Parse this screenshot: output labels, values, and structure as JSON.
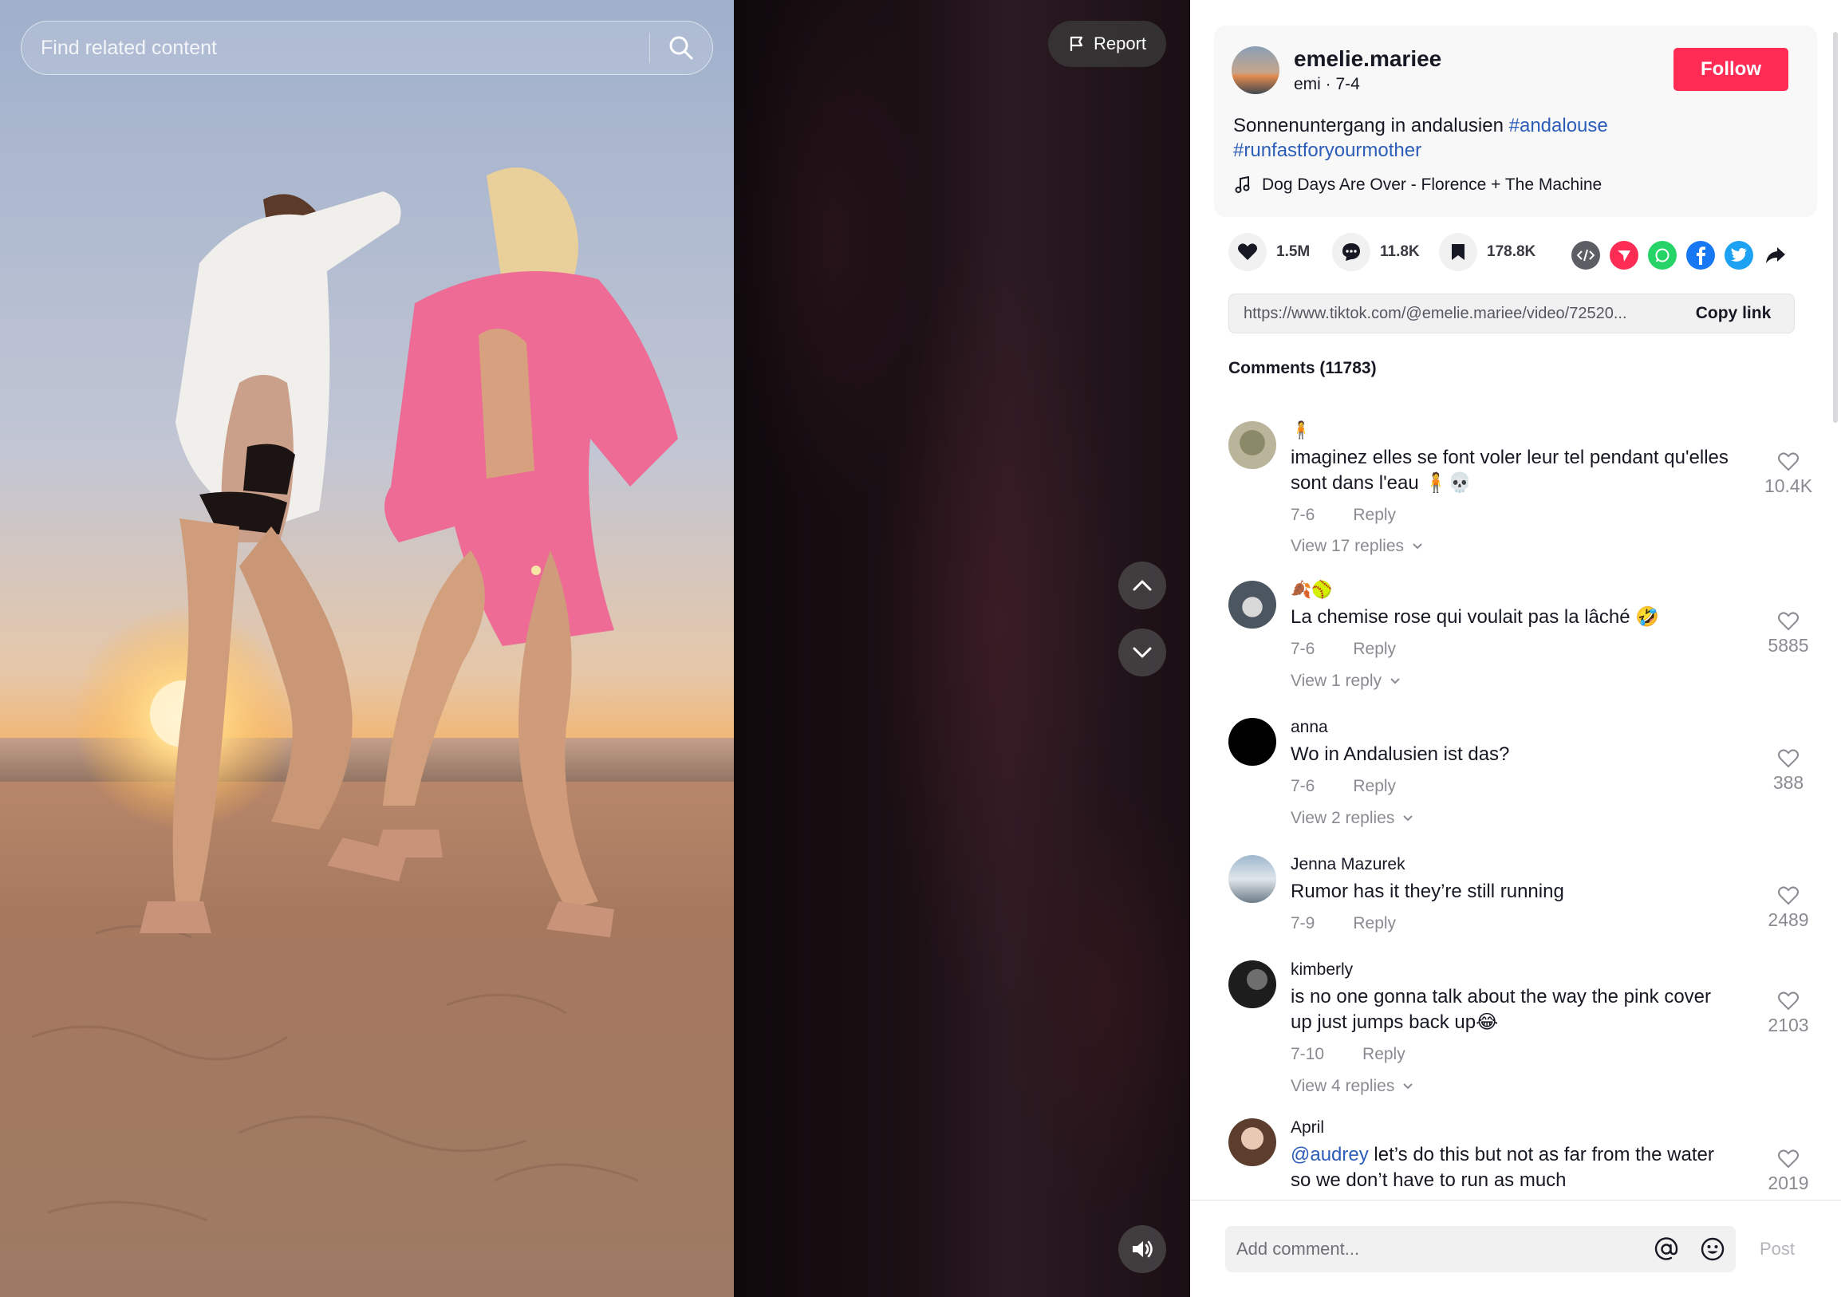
{
  "search": {
    "placeholder": "Find related content"
  },
  "report": {
    "label": "Report"
  },
  "author": {
    "username": "emelie.mariee",
    "subline": "emi · 7-4",
    "follow_label": "Follow"
  },
  "caption": {
    "text": "Sonnenuntergang in andalusien",
    "hashtags": [
      "#andalouse",
      "#runfastforyourmother"
    ]
  },
  "music": {
    "title": "Dog Days Are Over - Florence + The Machine"
  },
  "actions": {
    "likes": "1.5M",
    "comments": "11.8K",
    "saves": "178.8K"
  },
  "share": {
    "icons": [
      "embed-icon",
      "tiktok-send-icon",
      "whatsapp-icon",
      "facebook-icon",
      "twitter-icon",
      "share-arrow-icon"
    ]
  },
  "link": {
    "url": "https://www.tiktok.com/@emelie.mariee/video/72520...",
    "copy_label": "Copy link"
  },
  "comments_header": "Comments (11783)",
  "comments": [
    {
      "user": "🧍",
      "text": "imaginez elles se font voler leur tel pendant qu'elles sont dans l'eau 🧍💀",
      "date": "7-6",
      "reply": "Reply",
      "replies": "View 17 replies",
      "likes": "10.4K"
    },
    {
      "user": "🍂🥎",
      "text": "La chemise rose qui voulait pas la lâché 🤣",
      "date": "7-6",
      "reply": "Reply",
      "replies": "View 1 reply",
      "likes": "5885"
    },
    {
      "user": "anna",
      "text": "Wo in Andalusien ist das?",
      "date": "7-6",
      "reply": "Reply",
      "replies": "View 2 replies",
      "likes": "388"
    },
    {
      "user": "Jenna Mazurek",
      "text": "Rumor has it they’re still running",
      "date": "7-9",
      "reply": "Reply",
      "replies": "",
      "likes": "2489"
    },
    {
      "user": "kimberly",
      "text": "is no one gonna talk about the way the pink cover up just jumps back up😂",
      "date": "7-10",
      "reply": "Reply",
      "replies": "View 4 replies",
      "likes": "2103"
    },
    {
      "user": "April",
      "mention": "@audrey",
      "text": " let’s do this but not as far from the water so we don’t have to run as much",
      "date": "",
      "reply": "",
      "replies": "",
      "likes": "2019"
    }
  ],
  "add_comment": {
    "placeholder": "Add comment...",
    "post_label": "Post"
  },
  "colors": {
    "accent": "#fe2c55",
    "link": "#2b5db9",
    "muted": "#8a8b91"
  }
}
